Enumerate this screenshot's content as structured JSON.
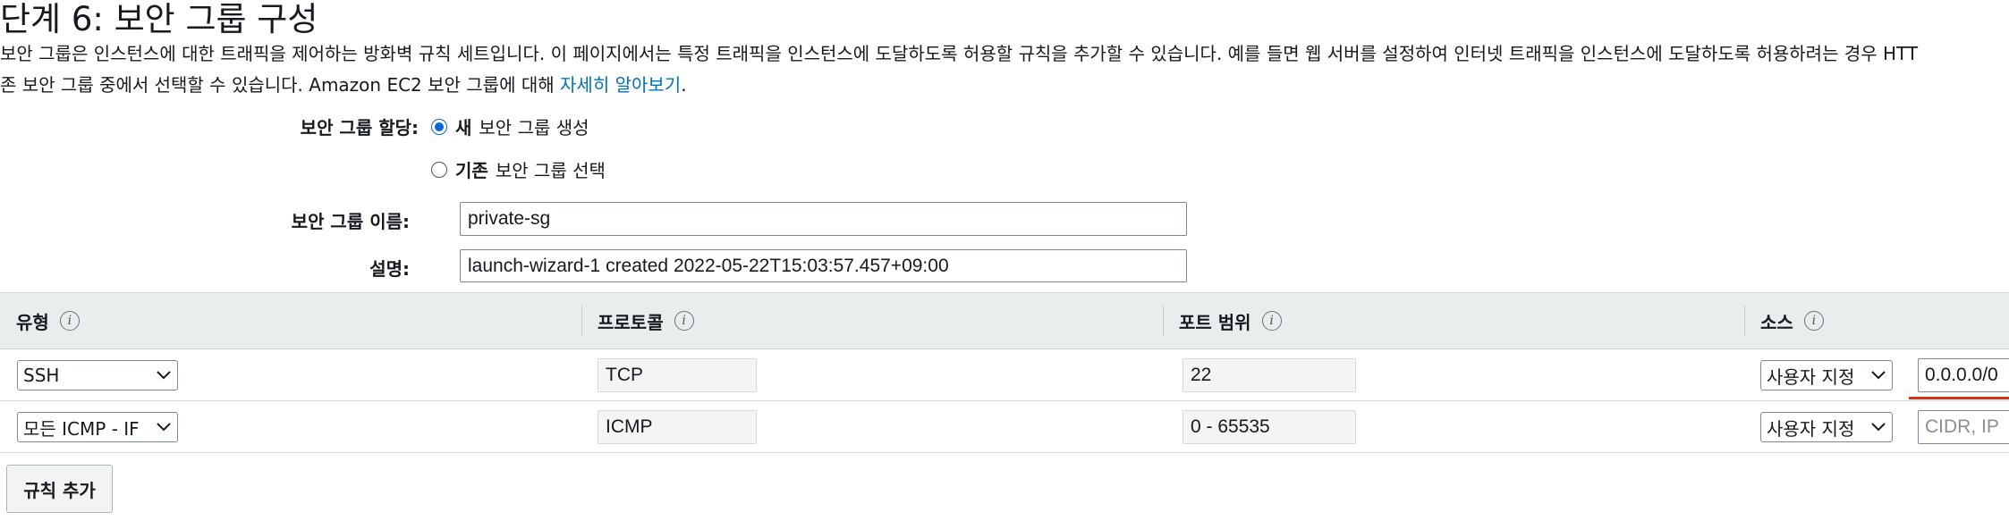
{
  "page": {
    "title": "단계 6: 보안 그룹 구성",
    "intro_line1": "보안 그룹은 인스턴스에 대한 트래픽을 제어하는 방화벽 규칙 세트입니다. 이 페이지에서는 특정 트래픽을 인스턴스에 도달하도록 허용할 규칙을 추가할 수 있습니다. 예를 들면 웹 서버를 설정하여 인터넷 트래픽을 인스턴스에 도달하도록 허용하려는 경우 HTT",
    "intro_line2": "존 보안 그룹 중에서 선택할 수 있습니다. Amazon EC2 보안 그룹에 대해 ",
    "learn_more_link": "자세히 알아보기",
    "learn_more_suffix": "."
  },
  "assignment": {
    "label": "보안 그룹 할당:",
    "new_option_strong": "새",
    "new_option_text": "보안 그룹 생성",
    "existing_option_strong": "기존",
    "existing_option_text": "보안 그룹 선택",
    "selected": "new"
  },
  "group_name": {
    "label": "보안 그룹 이름:",
    "value": "private-sg"
  },
  "description": {
    "label": "설명:",
    "value": "launch-wizard-1 created 2022-05-22T15:03:57.457+09:00"
  },
  "table": {
    "headers": {
      "type": "유형",
      "protocol": "프로토콜",
      "port_range": "포트 범위",
      "source": "소스"
    },
    "rows": [
      {
        "type": "SSH",
        "protocol": "TCP",
        "port_range": "22",
        "source_type": "사용자 지정",
        "source_value": "0.0.0.0/0",
        "source_placeholder": ""
      },
      {
        "type": "모든 ICMP - IF",
        "protocol": "ICMP",
        "port_range": "0 - 65535",
        "source_type": "사용자 지정",
        "source_value": "",
        "source_placeholder": "CIDR, IP"
      }
    ]
  },
  "actions": {
    "add_rule": "규칙 추가"
  },
  "icons": {
    "info": "info-icon",
    "dropdown": "chevron-down-icon"
  },
  "colors": {
    "link": "#0073bb",
    "radio_selected": "#0a66d6",
    "error_underline": "#d13212",
    "table_header_bg": "#eaeded"
  }
}
